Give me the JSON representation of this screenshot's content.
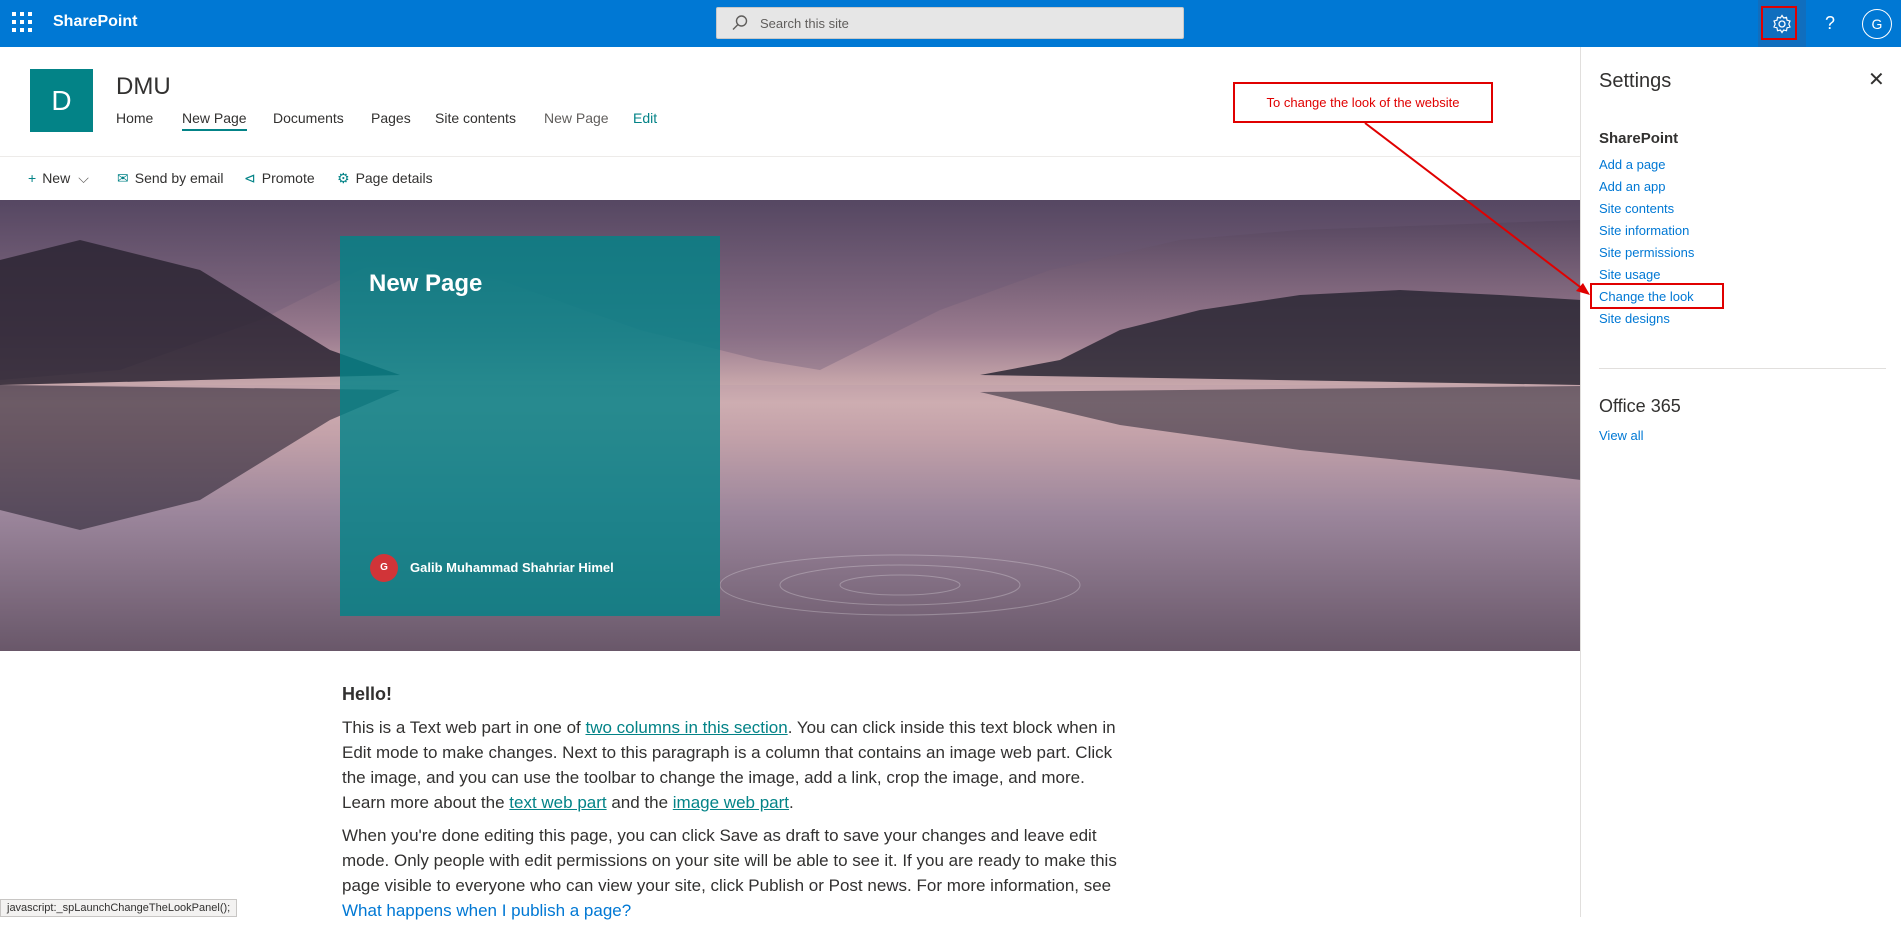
{
  "suitebar": {
    "app_name": "SharePoint",
    "search_placeholder": "Search this site",
    "help_label": "?",
    "user_initial": "G",
    "accent_color": "#0078d4"
  },
  "site": {
    "logo_letter": "D",
    "title": "DMU",
    "nav": [
      "Home",
      "New Page",
      "Documents",
      "Pages",
      "Site contents",
      "New Page",
      "Edit"
    ],
    "brand_color": "#038387"
  },
  "commandbar": {
    "new_label": "New",
    "send_label": "Send by email",
    "promote_label": "Promote",
    "details_label": "Page details"
  },
  "hero": {
    "title": "New Page",
    "author_initial": "G",
    "author_name": "Galib Muhammad Shahriar Himel"
  },
  "content": {
    "heading": "Hello!",
    "p1_a": "This is a Text web part in one of ",
    "p1_link1": "two columns in this section",
    "p1_b": ". You can click inside this text block when in Edit mode to make changes. Next to this paragraph is a column that contains an image web part. Click the image, and you can use the toolbar to change the image, add a link, crop the image, and more. Learn more about the ",
    "p1_link2": "text web part",
    "p1_c": " and the ",
    "p1_link3": "image web part",
    "p1_d": ".",
    "p2_a": "When you're done editing this page, you can click Save as draft to save your changes and leave edit mode. Only people with edit permissions on your site will be able to see it. If you are ready to make this page visible to everyone who can view your site, click Publish or Post news. For more information, see ",
    "p2_link": "What happens when I publish a page?"
  },
  "statusbar": {
    "text": "javascript:_spLaunchChangeTheLookPanel();"
  },
  "settings_panel": {
    "title": "Settings",
    "close_label": "✕",
    "sharepoint_heading": "SharePoint",
    "links": [
      "Add a page",
      "Add an app",
      "Site contents",
      "Site information",
      "Site permissions",
      "Site usage",
      "Change the look",
      "Site designs"
    ],
    "office_heading": "Office 365",
    "view_all": "View all"
  },
  "annotation": {
    "callout_text": "To change the look of the website",
    "color": "#e00000"
  }
}
